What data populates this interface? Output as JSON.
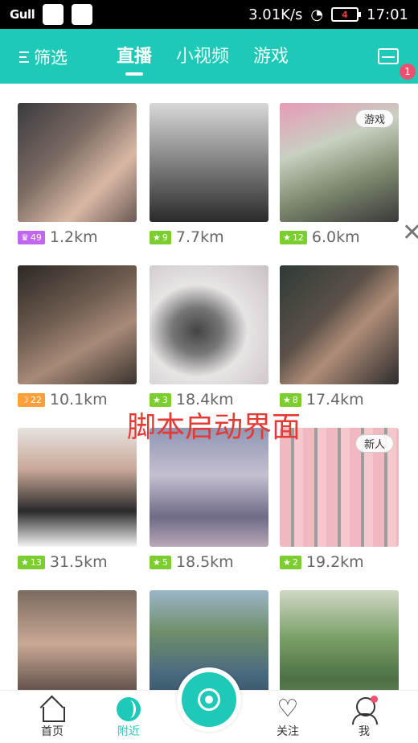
{
  "status_bar": {
    "signal": "Gull",
    "speed": "3.01K/s",
    "battery": "4",
    "time": "17:01"
  },
  "header": {
    "filter_label": "筛选",
    "tabs": [
      {
        "label": "直播",
        "active": true
      },
      {
        "label": "小视频",
        "active": false
      },
      {
        "label": "游戏",
        "active": false
      }
    ],
    "mail_badge": "1"
  },
  "cards": [
    {
      "level": "49",
      "level_color": "#c266f0",
      "level_icon": "crown-icon",
      "distance": "1.2km",
      "tag": ""
    },
    {
      "level": "9",
      "level_color": "#7ccd2f",
      "level_icon": "star-icon",
      "distance": "7.7km",
      "tag": ""
    },
    {
      "level": "12",
      "level_color": "#7ccd2f",
      "level_icon": "star-icon",
      "distance": "6.0km",
      "tag": "游戏"
    },
    {
      "level": "22",
      "level_color": "#ff9f3a",
      "level_icon": "moon-icon",
      "distance": "10.1km",
      "tag": ""
    },
    {
      "level": "3",
      "level_color": "#7ccd2f",
      "level_icon": "star-icon",
      "distance": "18.4km",
      "tag": ""
    },
    {
      "level": "8",
      "level_color": "#7ccd2f",
      "level_icon": "star-icon",
      "distance": "17.4km",
      "tag": ""
    },
    {
      "level": "13",
      "level_color": "#7ccd2f",
      "level_icon": "star-icon",
      "distance": "31.5km",
      "tag": ""
    },
    {
      "level": "5",
      "level_color": "#7ccd2f",
      "level_icon": "star-icon",
      "distance": "18.5km",
      "tag": ""
    },
    {
      "level": "2",
      "level_color": "#7ccd2f",
      "level_icon": "star-icon",
      "distance": "19.2km",
      "tag": "新人"
    },
    {
      "level": "",
      "level_color": "",
      "level_icon": "",
      "distance": "",
      "tag": ""
    },
    {
      "level": "",
      "level_color": "",
      "level_icon": "",
      "distance": "",
      "tag": ""
    },
    {
      "level": "",
      "level_color": "",
      "level_icon": "",
      "distance": "",
      "tag": ""
    }
  ],
  "overlay_text": "脚本启动界面",
  "bottom_nav": {
    "home": "首页",
    "nearby": "附近",
    "follow": "关注",
    "me": "我"
  },
  "colors": {
    "accent": "#1fc9b8",
    "badge": "#f0506e",
    "overlay": "#e53935"
  }
}
